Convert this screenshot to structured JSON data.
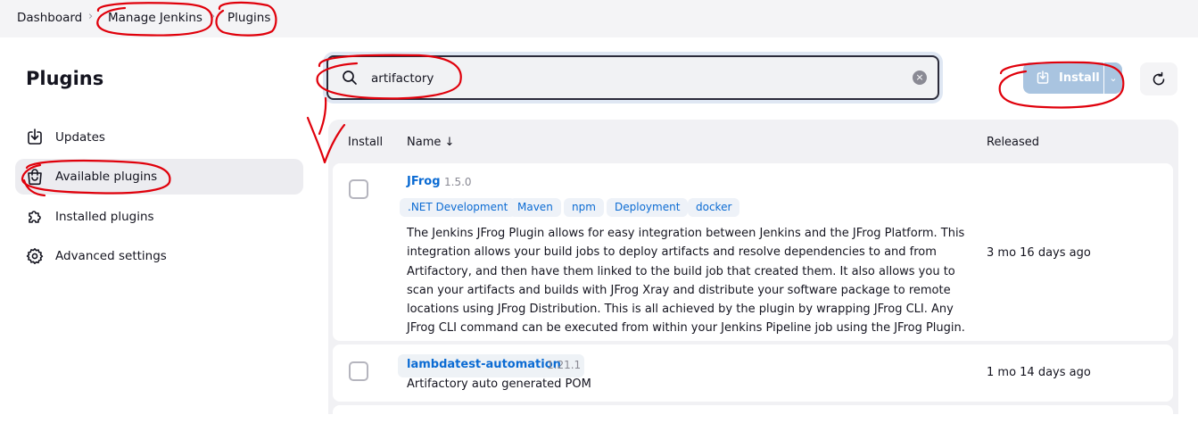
{
  "breadcrumb": [
    "Dashboard",
    "Manage Jenkins",
    "Plugins"
  ],
  "page_title": "Plugins",
  "sidebar": {
    "items": [
      {
        "label": "Updates",
        "icon": "download-icon",
        "active": false
      },
      {
        "label": "Available plugins",
        "icon": "shopping-bag-icon",
        "active": true
      },
      {
        "label": "Installed plugins",
        "icon": "puzzle-icon",
        "active": false
      },
      {
        "label": "Advanced settings",
        "icon": "gear-icon",
        "active": false
      }
    ]
  },
  "search": {
    "value": "artifactory",
    "icon": "search-icon",
    "clear_icon": "clear-icon"
  },
  "toolbar": {
    "install_label": "Install",
    "install_enabled": false
  },
  "table": {
    "columns": {
      "install": "Install",
      "name": "Name ↓",
      "released": "Released"
    },
    "rows": [
      {
        "name": "JFrog",
        "version": "1.5.0",
        "tags": [
          ".NET Development",
          "Maven",
          "npm",
          "Deployment",
          "docker"
        ],
        "description": "The Jenkins JFrog Plugin allows for easy integration between Jenkins and the JFrog Platform. This integration allows your build jobs to deploy artifacts and resolve dependencies to and from Artifactory, and then have them linked to the build job that created them. It also allows you to scan your artifacts and builds with JFrog Xray and distribute your software package to remote locations using JFrog Distribution. This is all achieved by the plugin by wrapping JFrog CLI. Any JFrog CLI command can be executed from within your Jenkins Pipeline job using the JFrog Plugin.",
        "released": "3 mo 16 days ago"
      },
      {
        "name": "lambdatest-automation",
        "version": "1.21.1",
        "description": "Artifactory auto generated POM",
        "released": "1 mo 14 days ago"
      }
    ]
  },
  "colors": {
    "accent": "#0b6bd3",
    "install_disabled": "#a9c4e0",
    "annotation": "#e0000b"
  }
}
